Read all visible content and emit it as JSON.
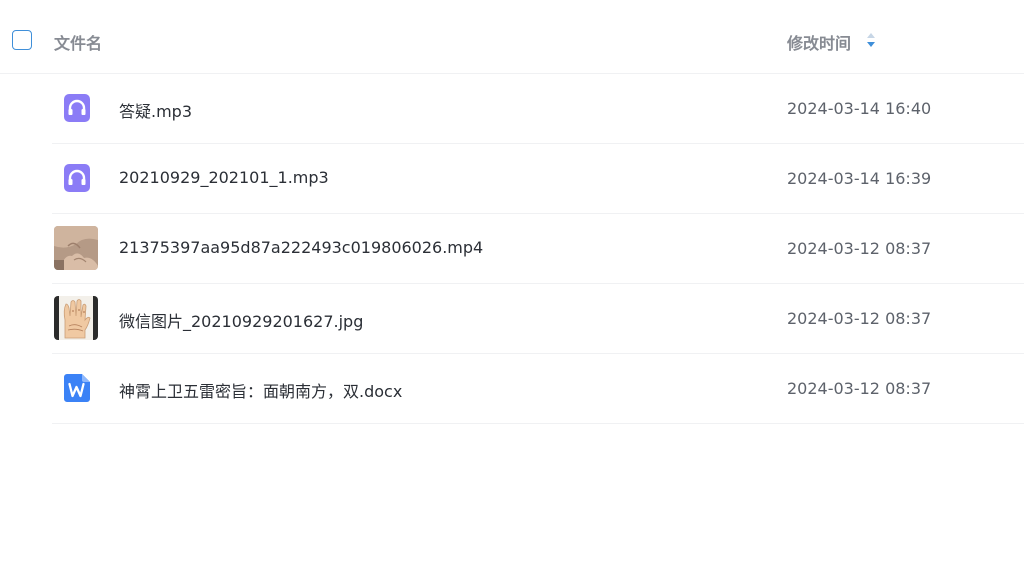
{
  "header": {
    "name_label": "文件名",
    "time_label": "修改时间"
  },
  "colors": {
    "accent": "#3f8fd9",
    "audio_icon": "#8b7cf6",
    "word_icon": "#3b82f6"
  },
  "files": [
    {
      "name": "答疑.mp3",
      "modified": "2024-03-14 16:40",
      "icon": "audio-file-icon"
    },
    {
      "name": "20210929_202101_1.mp3",
      "modified": "2024-03-14 16:39",
      "icon": "audio-file-icon"
    },
    {
      "name": "21375397aa95d87a222493c019806026.mp4",
      "modified": "2024-03-12 08:37",
      "icon": "video-thumbnail"
    },
    {
      "name": "微信图片_20210929201627.jpg",
      "modified": "2024-03-12 08:37",
      "icon": "image-thumbnail"
    },
    {
      "name": "神霄上卫五雷密旨：面朝南方，双.docx",
      "modified": "2024-03-12 08:37",
      "icon": "word-file-icon"
    }
  ]
}
